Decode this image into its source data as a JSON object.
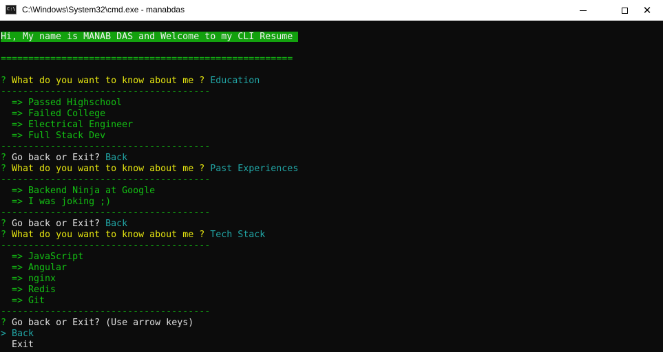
{
  "window": {
    "title": "C:\\Windows\\System32\\cmd.exe - manabdas",
    "icon_label": "C:\\",
    "icon": "cmd-icon",
    "controls": {
      "minimize": "—",
      "maximize": "☐",
      "close": "✕"
    }
  },
  "colors": {
    "console_bg": "#0c0c0c",
    "green": "#13c113",
    "yellow": "#e5e510",
    "white": "#e0e0e0",
    "cyan": "#21a6a6",
    "banner_bg": "#13a10e"
  },
  "console": {
    "banner": "Hi, My name is MANAB DAS and Welcome to my CLI Resume ",
    "rule_long": "=====================================================",
    "rule_short": "--------------------------------------",
    "prompt_mark": "?",
    "question": " What do you want to know about me ?",
    "go_back_prompt": " Go back or Exit?",
    "answers": [
      "Education",
      "Past Experiences",
      "Tech Stack"
    ],
    "back_answer": "Back",
    "education_items": [
      "  => Passed Highschool",
      "  => Failed College",
      "  => Electrical Engineer",
      "  => Full Stack Dev"
    ],
    "experience_items": [
      "  => Backend Ninja at Google",
      "  => I was joking ;)"
    ],
    "tech_items": [
      "  => JavaScript",
      "  => Angular",
      "  => nginx",
      "  => Redis",
      "  => Git"
    ],
    "hint": "(Use arrow keys)",
    "pointer": ">",
    "choices": [
      "Back",
      "Exit"
    ]
  }
}
